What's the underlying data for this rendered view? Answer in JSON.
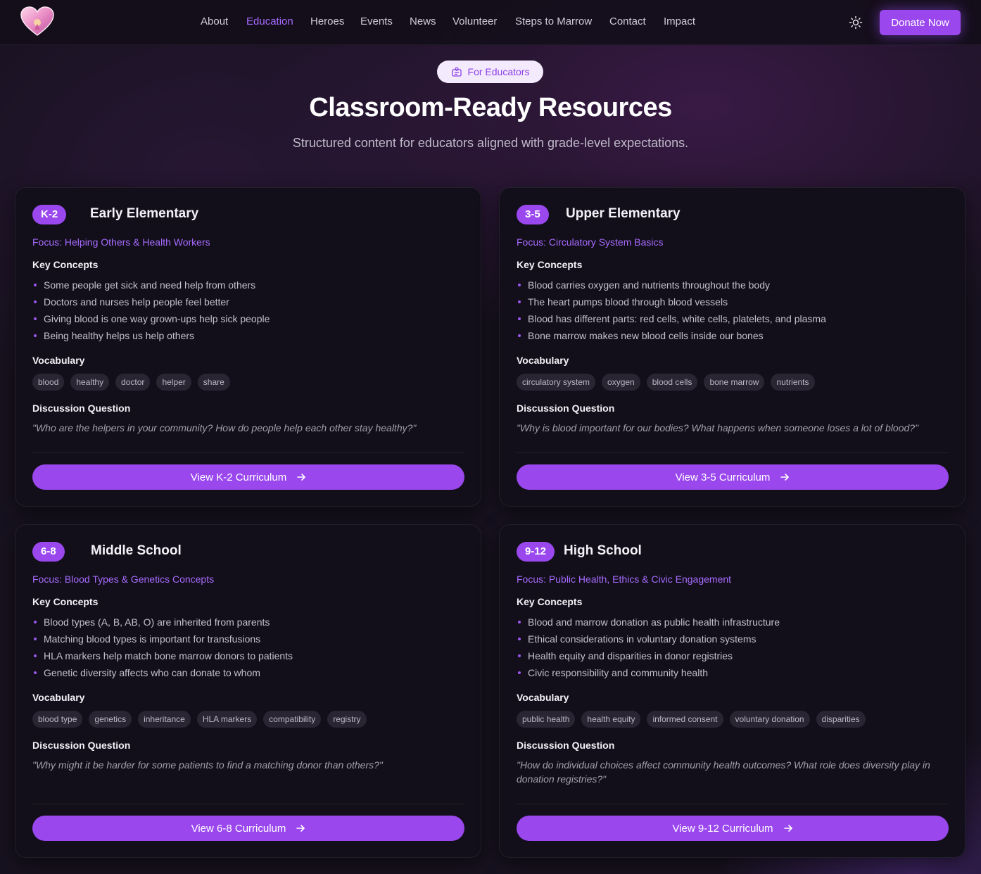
{
  "nav": {
    "logo_alt": "heart logo",
    "items": [
      {
        "label": "About"
      },
      {
        "label": "Education",
        "active": true
      },
      {
        "label": "Heroes"
      },
      {
        "label": "Events"
      },
      {
        "label": "News"
      },
      {
        "label": "Volunteer"
      },
      {
        "label": "Steps to Marrow"
      },
      {
        "label": "Contact"
      },
      {
        "label": "Impact"
      }
    ],
    "theme_icon": "sun-icon",
    "donate_label": "Donate Now"
  },
  "hero": {
    "badge_icon": "educator-icon",
    "badge_label": "For Educators",
    "title": "Classroom-Ready Resources",
    "subtitle": "Structured content for educators aligned with grade-level expectations."
  },
  "labels": {
    "key_concepts": "Key Concepts",
    "vocabulary": "Vocabulary",
    "discussion": "Discussion Question"
  },
  "cards": [
    {
      "grade": "K-2",
      "title": "Early Elementary",
      "focus": "Focus: Helping Others & Health Workers",
      "concepts": [
        "Some people get sick and need help from others",
        "Doctors and nurses help people feel better",
        "Giving blood is one way grown-ups help sick people",
        "Being healthy helps us help others"
      ],
      "vocab": [
        "blood",
        "healthy",
        "doctor",
        "helper",
        "share"
      ],
      "question": "\"Who are the helpers in your community? How do people help each other stay healthy?\"",
      "cta": "View K-2 Curriculum"
    },
    {
      "grade": "3-5",
      "title": "Upper Elementary",
      "focus": "Focus: Circulatory System Basics",
      "concepts": [
        "Blood carries oxygen and nutrients throughout the body",
        "The heart pumps blood through blood vessels",
        "Blood has different parts: red cells, white cells, platelets, and plasma",
        "Bone marrow makes new blood cells inside our bones"
      ],
      "vocab": [
        "circulatory system",
        "oxygen",
        "blood cells",
        "bone marrow",
        "nutrients"
      ],
      "question": "\"Why is blood important for our bodies? What happens when someone loses a lot of blood?\"",
      "cta": "View 3-5 Curriculum"
    },
    {
      "grade": "6-8",
      "title": "Middle School",
      "focus": "Focus: Blood Types & Genetics Concepts",
      "concepts": [
        "Blood types (A, B, AB, O) are inherited from parents",
        "Matching blood types is important for transfusions",
        "HLA markers help match bone marrow donors to patients",
        "Genetic diversity affects who can donate to whom"
      ],
      "vocab": [
        "blood type",
        "genetics",
        "inheritance",
        "HLA markers",
        "compatibility",
        "registry"
      ],
      "question": "\"Why might it be harder for some patients to find a matching donor than others?\"",
      "cta": "View 6-8 Curriculum"
    },
    {
      "grade": "9-12",
      "title": "High School",
      "focus": "Focus: Public Health, Ethics & Civic Engagement",
      "concepts": [
        "Blood and marrow donation as public health infrastructure",
        "Ethical considerations in voluntary donation systems",
        "Health equity and disparities in donor registries",
        "Civic responsibility and community health"
      ],
      "vocab": [
        "public health",
        "health equity",
        "informed consent",
        "voluntary donation",
        "disparities"
      ],
      "question": "\"How do individual choices affect community health outcomes? What role does diversity play in donation registries?\"",
      "cta": "View 9-12 Curriculum"
    }
  ],
  "colors": {
    "accent": "#9a48ee",
    "accent_text": "#a66bff",
    "background": "#17121f",
    "card": "#130f1a"
  }
}
